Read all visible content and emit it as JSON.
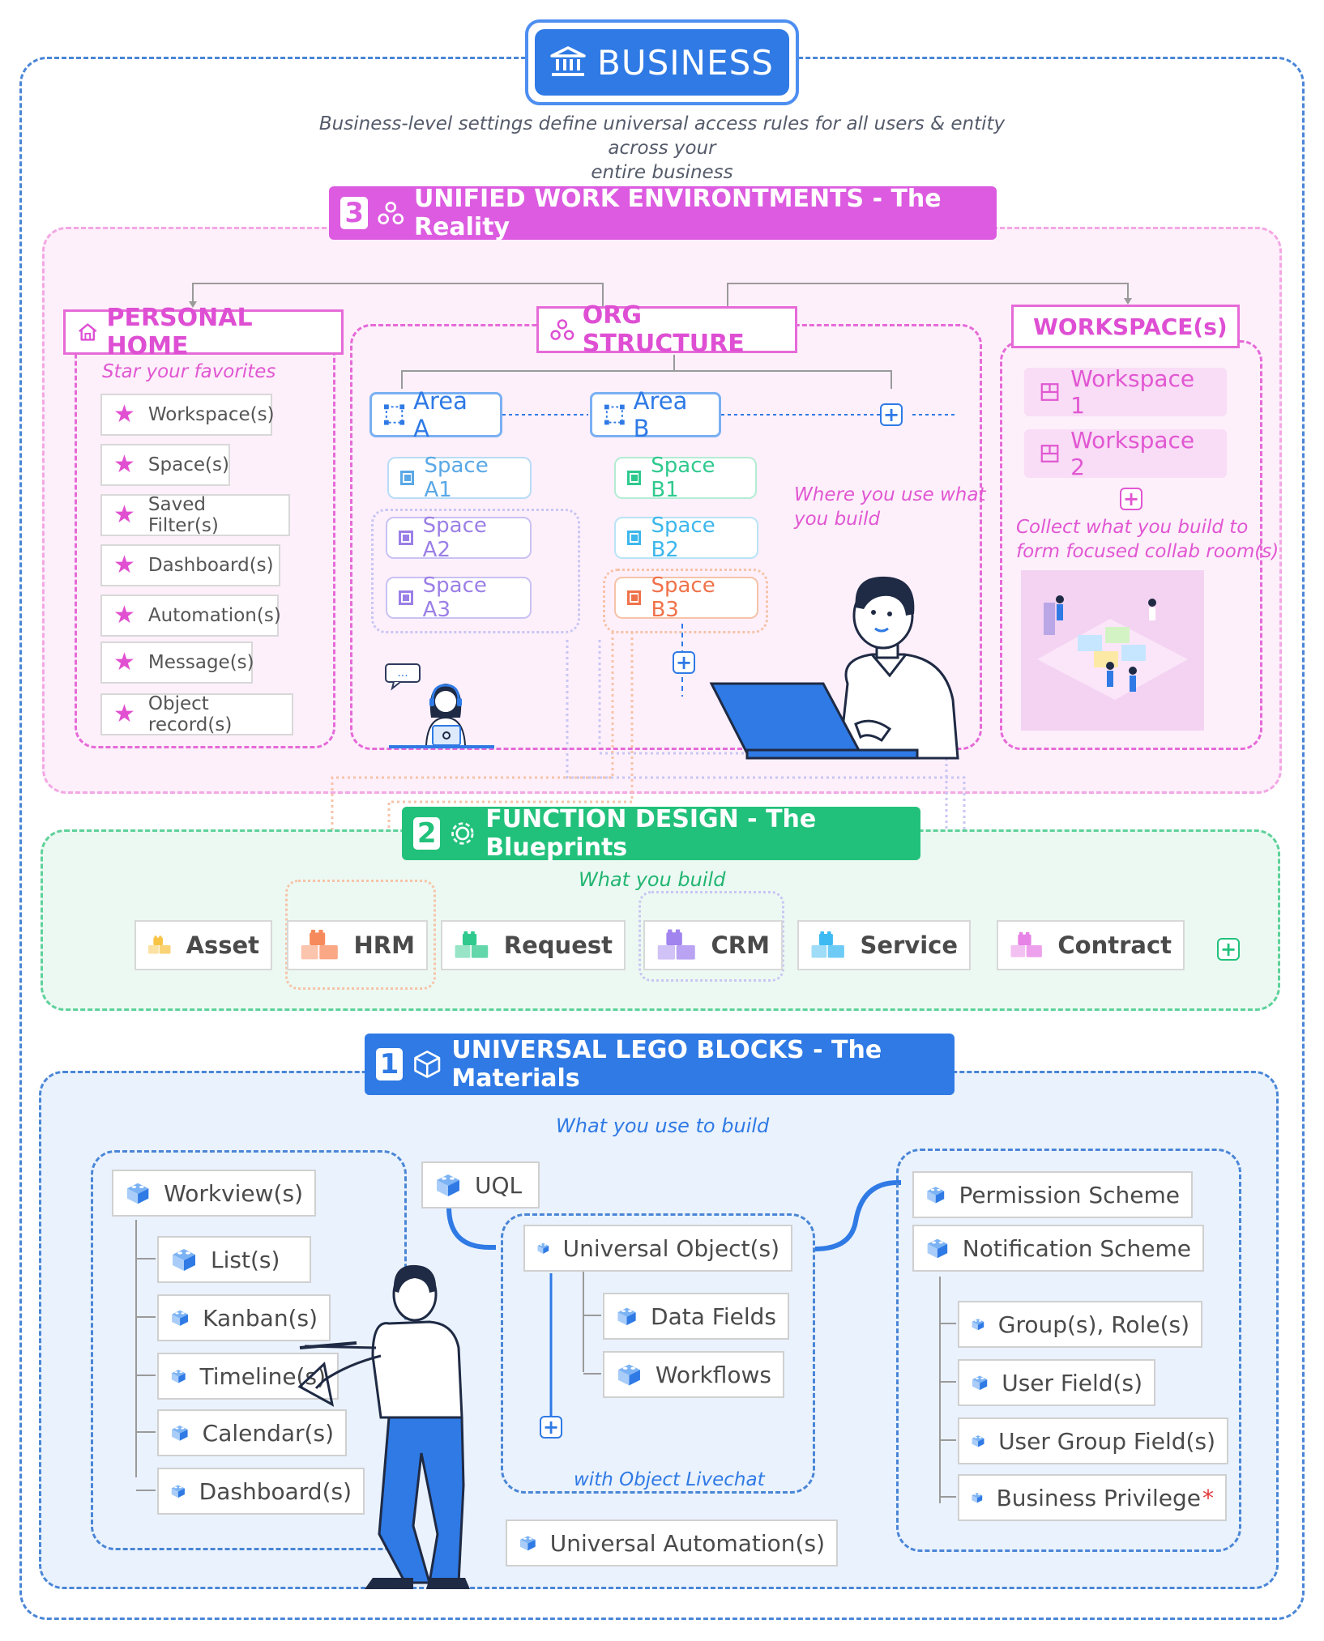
{
  "business": {
    "title": "BUSINESS",
    "subtitle_line1": "Business-level settings define universal access rules for all users & entity across your",
    "subtitle_line2": "entire business"
  },
  "section3": {
    "number": "3",
    "title": "UNIFIED WORK ENVIRONTMENTS - The Reality",
    "personal_home": {
      "title": "PERSONAL HOME",
      "hint": "Star your favorites",
      "items": [
        "Workspace(s)",
        "Space(s)",
        "Saved Filter(s)",
        "Dashboard(s)",
        "Automation(s)",
        "Message(s)",
        "Object record(s)"
      ]
    },
    "org": {
      "title": "ORG STRUCTURE",
      "area_a": "Area A",
      "area_b": "Area B",
      "spaces_a": [
        "Space A1",
        "Space A2",
        "Space A3"
      ],
      "spaces_b": [
        "Space B1",
        "Space B2",
        "Space B3"
      ],
      "note_line1": "Where you use what",
      "note_line2": "you build",
      "chat_bubble": "..."
    },
    "workspaces": {
      "title": "WORKSPACE(s)",
      "items": [
        "Workspace 1",
        "Workspace 2"
      ],
      "note_line1": "Collect what you build to",
      "note_line2": "form focused collab room(s)"
    }
  },
  "section2": {
    "number": "2",
    "title": "FUNCTION DESIGN - The Blueprints",
    "hint": "What you build",
    "modules": [
      {
        "label": "Asset",
        "color": "#f7c445"
      },
      {
        "label": "HRM",
        "color": "#f78a5c"
      },
      {
        "label": "Request",
        "color": "#2fc98e"
      },
      {
        "label": "CRM",
        "color": "#a184ee"
      },
      {
        "label": "Service",
        "color": "#3dbaf2"
      },
      {
        "label": "Contract",
        "color": "#e782e6"
      }
    ]
  },
  "section1": {
    "number": "1",
    "title": "UNIVERSAL LEGO BLOCKS - The Materials",
    "hint": "What you use to build",
    "workview": {
      "title": "Workview(s)",
      "items": [
        "List(s)",
        "Kanban(s)",
        "Timeline(s)",
        "Calendar(s)",
        "Dashboard(s)"
      ]
    },
    "uql": "UQL",
    "object": {
      "title": "Universal Object(s)",
      "items": [
        "Data Fields",
        "Workflows"
      ],
      "note": "with Object Livechat"
    },
    "automation": "Universal Automation(s)",
    "schemes": {
      "items": [
        "Permission Scheme",
        "Notification Scheme"
      ],
      "sub_items": [
        "Group(s), Role(s)",
        "User Field(s)",
        "User Group Field(s)",
        "Business Privilege"
      ],
      "asterisk": "*"
    }
  },
  "colors": {
    "blue": "#2f7ae5",
    "pink": "#dc5be0",
    "green": "#22c17b"
  }
}
